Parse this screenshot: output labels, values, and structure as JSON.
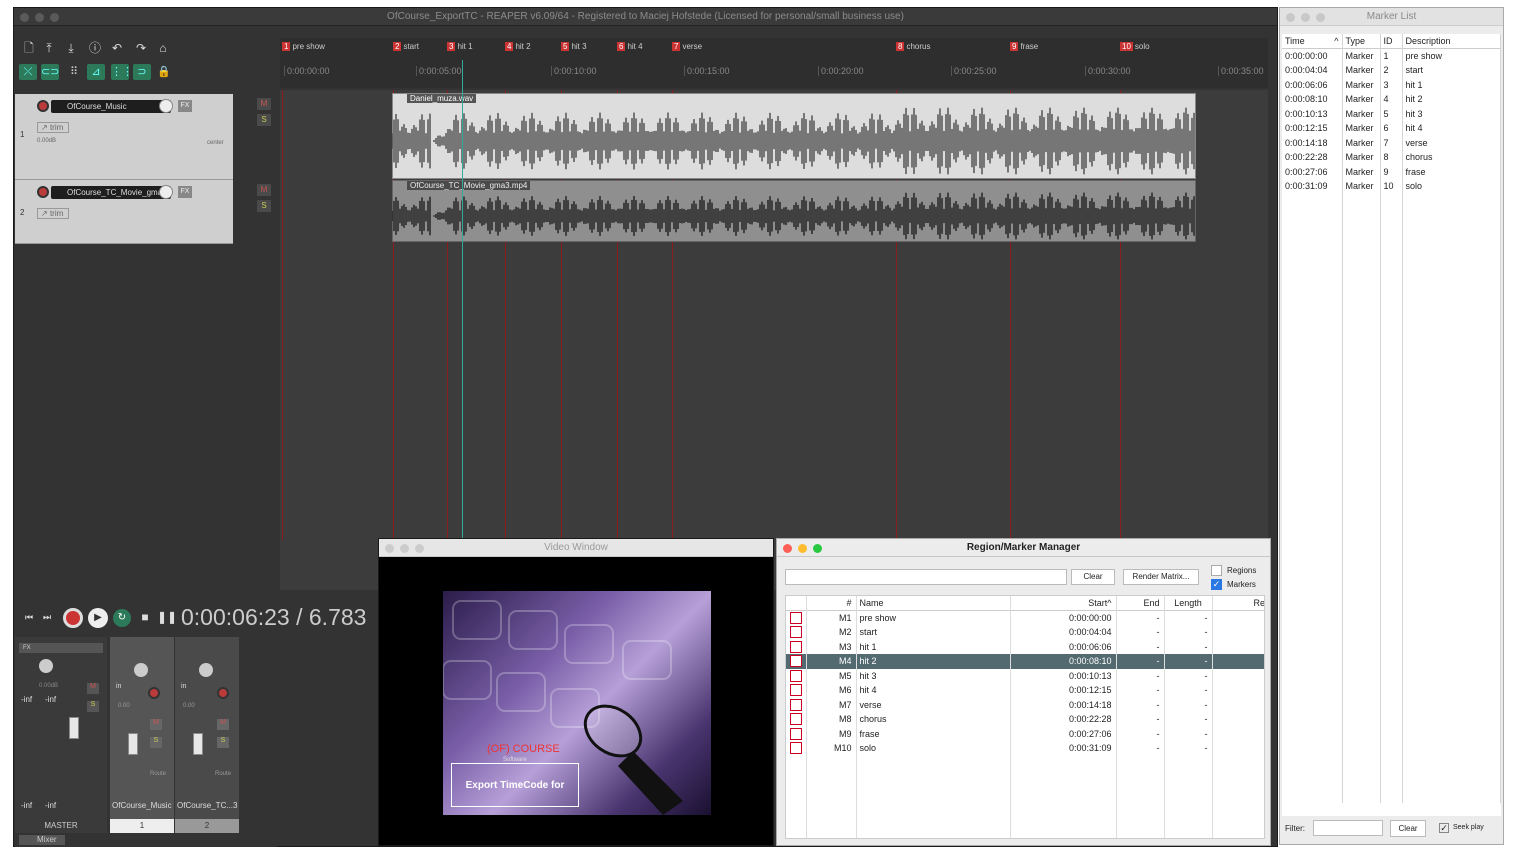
{
  "main_window": {
    "title": "OfCourse_ExportTC - REAPER v6.09/64 - Registered to Maciej Hofstede (Licensed for personal/small business use)"
  },
  "markers_ruler": [
    {
      "num": "1",
      "label": "pre show"
    },
    {
      "num": "2",
      "label": "start"
    },
    {
      "num": "3",
      "label": "hit 1"
    },
    {
      "num": "4",
      "label": "hit 2"
    },
    {
      "num": "5",
      "label": "hit 3"
    },
    {
      "num": "6",
      "label": "hit 4"
    },
    {
      "num": "7",
      "label": "verse"
    },
    {
      "num": "8",
      "label": "chorus"
    },
    {
      "num": "9",
      "label": "frase"
    },
    {
      "num": "10",
      "label": "solo"
    }
  ],
  "timeline_ticks": [
    "0:00:00:00",
    "0:00:05:00",
    "0:00:10:00",
    "0:00:15:00",
    "0:00:20:00",
    "0:00:25:00",
    "0:00:30:00",
    "0:00:35:00"
  ],
  "tracks": [
    {
      "num": "1",
      "name": "OfCourse_Music",
      "trim": "trim",
      "vol": "0.00dB",
      "pan": "center",
      "fx": "FX",
      "item": "Daniel_muza.wav"
    },
    {
      "num": "2",
      "name": "OfCourse_TC_Movie_gma3",
      "trim": "trim",
      "fx": "FX",
      "item": "OfCourse_TC_Movie_gma3.mp4"
    }
  ],
  "track_buttons": {
    "mute": "M",
    "solo": "S"
  },
  "transport": {
    "time": "0:00:06:23 / 6.783"
  },
  "mixer": {
    "master_label": "MASTER",
    "master_vol": "0.00dB",
    "inf_left": "-inf",
    "inf_right": "-inf",
    "ch1_name": "OfCourse_Music",
    "ch2_name": "OfCourse_TC...3",
    "ch1_num": "1",
    "ch2_num": "2",
    "vol_value": "0.00",
    "route": "Route",
    "trim": "trim",
    "in": "in",
    "tab_label": "Mixer",
    "scale": [
      "12",
      "6",
      "0",
      "-6",
      "-12",
      "-18",
      "-24",
      "-30",
      "-36",
      "-42",
      "-54"
    ]
  },
  "video_window": {
    "title": "Video Window",
    "logo_text": "(OF) COURSE",
    "logo_sub": "Software",
    "banner": "Export TimeCode for gma3"
  },
  "region_manager": {
    "title": "Region/Marker Manager",
    "clear_label": "Clear",
    "render_label": "Render Matrix...",
    "regions_label": "Regions",
    "markers_label": "Markers",
    "headers": [
      "#",
      "Name",
      "Start",
      "End",
      "Length",
      "Re"
    ],
    "rows": [
      {
        "id": "M1",
        "name": "pre show",
        "start": "0:00:00:00",
        "end": "-",
        "length": "-"
      },
      {
        "id": "M2",
        "name": "start",
        "start": "0:00:04:04",
        "end": "-",
        "length": "-"
      },
      {
        "id": "M3",
        "name": "hit 1",
        "start": "0:00:06:06",
        "end": "-",
        "length": "-"
      },
      {
        "id": "M4",
        "name": "hit 2",
        "start": "0:00:08:10",
        "end": "-",
        "length": "-"
      },
      {
        "id": "M5",
        "name": "hit 3",
        "start": "0:00:10:13",
        "end": "-",
        "length": "-"
      },
      {
        "id": "M6",
        "name": "hit 4",
        "start": "0:00:12:15",
        "end": "-",
        "length": "-"
      },
      {
        "id": "M7",
        "name": "verse",
        "start": "0:00:14:18",
        "end": "-",
        "length": "-"
      },
      {
        "id": "M8",
        "name": "chorus",
        "start": "0:00:22:28",
        "end": "-",
        "length": "-"
      },
      {
        "id": "M9",
        "name": "frase",
        "start": "0:00:27:06",
        "end": "-",
        "length": "-"
      },
      {
        "id": "M10",
        "name": "solo",
        "start": "0:00:31:09",
        "end": "-",
        "length": "-"
      }
    ],
    "selected_row": "M4"
  },
  "marker_list": {
    "title": "Marker List",
    "headers": [
      "Time",
      "Type",
      "ID",
      "Description"
    ],
    "rows": [
      {
        "time": "0:00:00:00",
        "type": "Marker",
        "id": "1",
        "desc": "pre show"
      },
      {
        "time": "0:00:04:04",
        "type": "Marker",
        "id": "2",
        "desc": "start"
      },
      {
        "time": "0:00:06:06",
        "type": "Marker",
        "id": "3",
        "desc": "hit 1"
      },
      {
        "time": "0:00:08:10",
        "type": "Marker",
        "id": "4",
        "desc": "hit 2"
      },
      {
        "time": "0:00:10:13",
        "type": "Marker",
        "id": "5",
        "desc": "hit 3"
      },
      {
        "time": "0:00:12:15",
        "type": "Marker",
        "id": "6",
        "desc": "hit 4"
      },
      {
        "time": "0:00:14:18",
        "type": "Marker",
        "id": "7",
        "desc": "verse"
      },
      {
        "time": "0:00:22:28",
        "type": "Marker",
        "id": "8",
        "desc": "chorus"
      },
      {
        "time": "0:00:27:06",
        "type": "Marker",
        "id": "9",
        "desc": "frase"
      },
      {
        "time": "0:00:31:09",
        "type": "Marker",
        "id": "10",
        "desc": "solo"
      }
    ],
    "filter_label": "Filter:",
    "clear_label": "Clear",
    "seek_label": "Seek play"
  },
  "colors": {
    "marker_red": "#c33333",
    "selected_row": "#536a70",
    "toolbar_green": "#2d7a5a"
  }
}
